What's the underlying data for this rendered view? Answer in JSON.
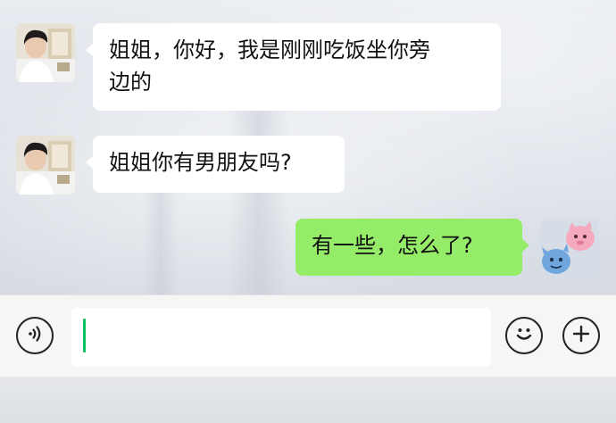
{
  "messages": [
    {
      "side": "left",
      "lines": [
        "姐姐，你好，我是刚刚吃饭坐你旁",
        "边的"
      ]
    },
    {
      "side": "left",
      "lines": [
        "姐姐你有男朋友吗?"
      ]
    },
    {
      "side": "right",
      "lines": [
        "有一些，怎么了?"
      ]
    }
  ],
  "input_bar": {
    "voice_icon": "voice-icon",
    "emoji_icon": "emoji-icon",
    "plus_icon": "plus-icon",
    "text_value": ""
  },
  "colors": {
    "incoming_bubble": "#ffffff",
    "outgoing_bubble": "#95ec69",
    "cursor": "#07c160"
  }
}
